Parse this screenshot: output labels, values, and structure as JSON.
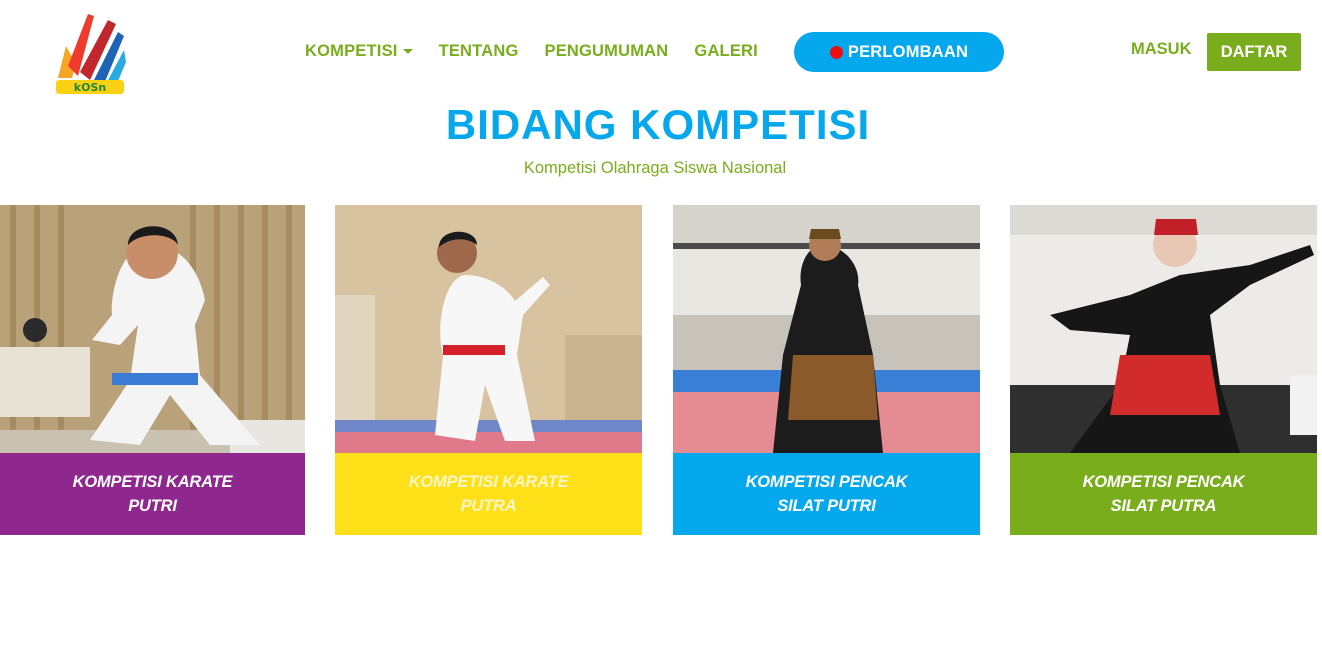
{
  "header": {
    "logo_text": "kOSn",
    "nav": [
      {
        "label": "KOMPETISI"
      },
      {
        "label": "TENTANG"
      },
      {
        "label": "PENGUMUMAN"
      },
      {
        "label": "GALERI"
      }
    ],
    "cta_label": "PERLOMBAAN",
    "login_label": "MASUK",
    "register_label": "DAFTAR"
  },
  "section": {
    "title": "BIDANG KOMPETISI",
    "subtitle": "Kompetisi Olahraga Siswa Nasional"
  },
  "cards": [
    {
      "line1": "KOMPETISI KARATE",
      "line2": "PUTRI",
      "color": "#8e278e"
    },
    {
      "line1": "KOMPETISI KARATE",
      "line2": "PUTRA",
      "color": "#fde018"
    },
    {
      "line1": "KOMPETISI PENCAK",
      "line2": "SILAT PUTRI",
      "color": "#05a8ec"
    },
    {
      "line1": "KOMPETISI PENCAK",
      "line2": "SILAT PUTRA",
      "color": "#79ad1b"
    }
  ],
  "colors": {
    "primary_blue": "#05a8ec",
    "primary_green": "#79ad1b",
    "live_red": "#ee0d15"
  },
  "icons": [
    "kosn-logo-icon",
    "caret-down-icon",
    "live-dot-icon"
  ]
}
